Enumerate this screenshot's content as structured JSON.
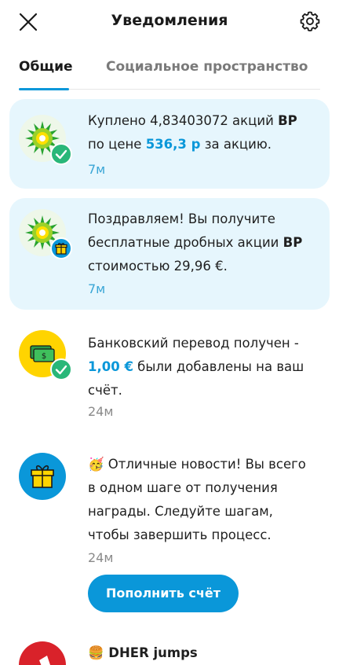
{
  "header": {
    "title": "Уведомления"
  },
  "tabs": [
    {
      "label": "Общие",
      "active": true
    },
    {
      "label": "Социальное пространство",
      "active": false
    }
  ],
  "notifications": [
    {
      "text_pre": "Куплено 4,83403072 акций ",
      "text_bold": "BP",
      "text_mid": " по цене ",
      "text_hl": "536,3 р",
      "text_post": " за акцию.",
      "time": "7м"
    },
    {
      "text_pre": "Поздравляем! Вы получите бесплатные дробных акции ",
      "text_bold": "BP",
      "text_post": " стоимостью 29,96 €.",
      "time": "7м"
    },
    {
      "text_pre": "Банковский перевод получен - ",
      "text_hl": "1,00 €",
      "text_post": " были добавлены на ваш счёт.",
      "time": "24м"
    },
    {
      "emoji": "🥳",
      "text": " Отличные новости! Вы всего в одном шаге от получения награды. Следуйте шагам, чтобы завершить процесс.",
      "time": "24м",
      "button": "Пополнить счёт"
    },
    {
      "emoji": "🍔",
      "text": " DHER jumps"
    }
  ],
  "colors": {
    "accent": "#0a97d9",
    "unread_bg": "#e6f6fd",
    "success": "#29b779",
    "cash_circle": "#ffd400",
    "gift_circle": "#0a97d9",
    "red_circle": "#d9222a"
  }
}
